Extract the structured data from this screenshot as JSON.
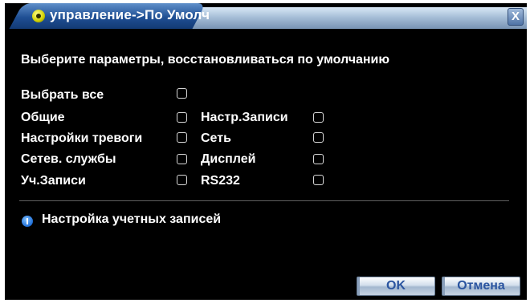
{
  "window": {
    "title": "управление->По Умолч",
    "close_label": "X"
  },
  "main": {
    "instruction": "Выберите параметры, восстановливаться по умолчанию",
    "select_all": {
      "label": "Выбрать все",
      "checked": false
    },
    "options": [
      {
        "label": "Общие",
        "checked": false
      },
      {
        "label": "Настр.Записи",
        "checked": false
      },
      {
        "label": "Настройки тревоги",
        "checked": false
      },
      {
        "label": "Сеть",
        "checked": false
      },
      {
        "label": "Сетев. службы",
        "checked": false
      },
      {
        "label": "Дисплей",
        "checked": false
      },
      {
        "label": "Уч.Записи",
        "checked": false
      },
      {
        "label": "RS232",
        "checked": false
      }
    ],
    "info_text": "Настройка учетных записей"
  },
  "buttons": {
    "ok_label": "OK",
    "cancel_label": "Отмена"
  }
}
